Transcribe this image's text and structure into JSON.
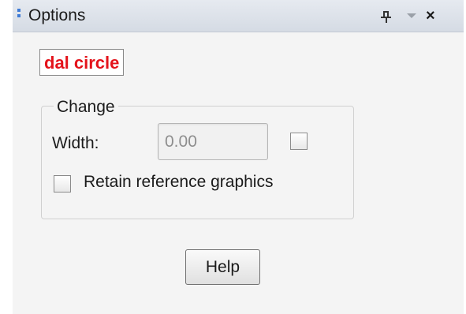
{
  "panel": {
    "title": "Options",
    "icons": [
      "grip-icon",
      "pin-icon",
      "dropdown-icon",
      "close-icon"
    ],
    "close_glyph": "×"
  },
  "mode_label": "dal circle",
  "change_group": {
    "legend": "Change",
    "width_label": "Width:",
    "width_value": "0.00",
    "width_checked": false,
    "retain_label": "Retain reference graphics",
    "retain_checked": false
  },
  "help_button": "Help",
  "colors": {
    "mode_label_text": "#e4131b",
    "grip_accent": "#3e7bd6",
    "panel_background": "#f4f4f4"
  }
}
